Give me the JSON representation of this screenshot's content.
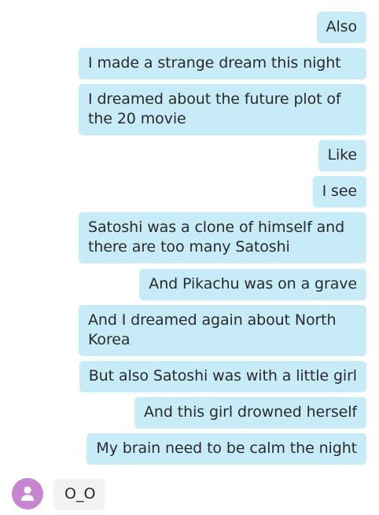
{
  "colors": {
    "outgoing_bubble": "#c7ecf8",
    "incoming_bubble": "#f1f2f3",
    "avatar": "#c784cf"
  },
  "messages": [
    {
      "direction": "outgoing",
      "text": "Also"
    },
    {
      "direction": "outgoing",
      "text": "I made a strange dream this night"
    },
    {
      "direction": "outgoing",
      "text": "I dreamed about the future plot of the 20 movie"
    },
    {
      "direction": "outgoing",
      "text": "Like"
    },
    {
      "direction": "outgoing",
      "text": "I see"
    },
    {
      "direction": "outgoing",
      "text": "Satoshi was a clone of himself and there are too many Satoshi"
    },
    {
      "direction": "outgoing",
      "text": "And Pikachu was on a grave"
    },
    {
      "direction": "outgoing",
      "text": "And I dreamed again about North Korea"
    },
    {
      "direction": "outgoing",
      "text": "But also Satoshi was with a little girl"
    },
    {
      "direction": "outgoing",
      "text": "And this girl drowned herself"
    },
    {
      "direction": "outgoing",
      "text": "My brain need to be calm the night"
    },
    {
      "direction": "incoming",
      "text": "O_O",
      "avatar_icon": "user-silhouette-icon"
    }
  ]
}
